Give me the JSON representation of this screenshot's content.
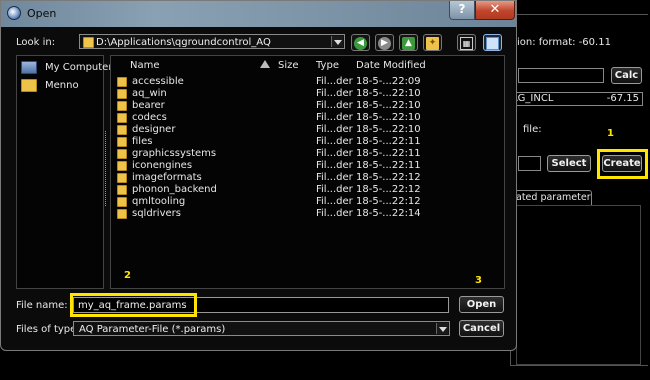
{
  "dialog": {
    "title": "Open",
    "help_label": "?",
    "close_label": "✕",
    "look_in_label": "Look in:",
    "look_in_path": "D:\\Applications\\qgroundcontrol_AQ",
    "toolbar": [
      "back-icon",
      "forward-icon",
      "up-icon",
      "new-folder-icon",
      "list-view-icon",
      "detail-view-icon"
    ],
    "sidebar": [
      {
        "label": "My Computer",
        "icon": "computer-icon"
      },
      {
        "label": "Menno",
        "icon": "user-folder-icon"
      }
    ],
    "columns": {
      "name": "Name",
      "size": "Size",
      "type": "Type",
      "date": "Date Modified"
    },
    "files": [
      {
        "name": "accessible",
        "type": "Fil...der",
        "date": "18-5-...22:09"
      },
      {
        "name": "aq_win",
        "type": "Fil...der",
        "date": "18-5-...22:10"
      },
      {
        "name": "bearer",
        "type": "Fil...der",
        "date": "18-5-...22:10"
      },
      {
        "name": "codecs",
        "type": "Fil...der",
        "date": "18-5-...22:10"
      },
      {
        "name": "designer",
        "type": "Fil...der",
        "date": "18-5-...22:10"
      },
      {
        "name": "files",
        "type": "Fil...der",
        "date": "18-5-...22:11"
      },
      {
        "name": "graphicssystems",
        "type": "Fil...der",
        "date": "18-5-...22:11"
      },
      {
        "name": "iconengines",
        "type": "Fil...der",
        "date": "18-5-...22:11"
      },
      {
        "name": "imageformats",
        "type": "Fil...der",
        "date": "18-5-...22:12"
      },
      {
        "name": "phonon_backend",
        "type": "Fil...der",
        "date": "18-5-...22:12"
      },
      {
        "name": "qmltooling",
        "type": "Fil...der",
        "date": "18-5-...22:12"
      },
      {
        "name": "sqldrivers",
        "type": "Fil...der",
        "date": "18-5-...22:14"
      }
    ],
    "file_name_label": "File name:",
    "file_name_value": "my_aq_frame.params",
    "files_of_type_label": "Files of type:",
    "files_of_type_value": "AQ Parameter-File (*.params)",
    "open_button": "Open",
    "cancel_button": "Cancel"
  },
  "background": {
    "format_text": "ion: format: -60.11",
    "calc_button": "Calc",
    "param_name": "AG_INCL",
    "param_value": "-67.15",
    "file_label": "file:",
    "select_button": "Select",
    "create_button": "Create",
    "tab_label": "ated parameter"
  },
  "annotations": {
    "step1": "1",
    "step2": "2",
    "step3": "3"
  },
  "colors": {
    "highlight": "#ffe500",
    "titlebar": "#8aa0b3",
    "close": "#c0452b",
    "folder": "#efc24a"
  }
}
